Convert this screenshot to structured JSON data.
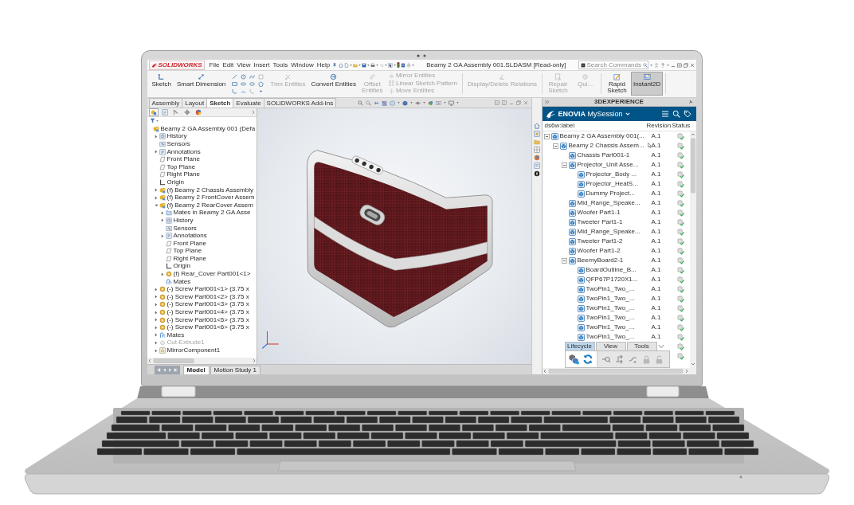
{
  "menu_bar": {
    "logo": "SOLIDWORKS",
    "menus": [
      "File",
      "Edit",
      "View",
      "Insert",
      "Tools",
      "Window",
      "Help"
    ],
    "title": "Beamy 2 GA Assembly 001.SLDASM [Read-only]",
    "search": {
      "placeholder": "Search Commands"
    }
  },
  "ribbon": {
    "commands": [
      {
        "kind": "large",
        "label": "Sketch",
        "disabled": false,
        "on": false
      },
      {
        "kind": "large",
        "label": "Smart Dimension",
        "disabled": false,
        "on": false
      },
      {
        "kind": "tools"
      },
      {
        "kind": "large",
        "label": "Trim Entities",
        "disabled": true,
        "on": false
      },
      {
        "kind": "large",
        "label": "Convert Entities",
        "disabled": false,
        "on": false
      },
      {
        "kind": "compact",
        "label": "Offset Entities",
        "disabled": true,
        "on": false
      },
      {
        "kind": "stack",
        "items": [
          {
            "label": "Mirror Entities",
            "disabled": true
          },
          {
            "label": "Linear Sketch Pattern",
            "disabled": true
          },
          {
            "label": "Move Entities",
            "disabled": true
          }
        ]
      },
      {
        "kind": "large",
        "label": "Display/Delete Relations",
        "disabled": true,
        "on": false
      },
      {
        "kind": "compact",
        "label": "Repair Sketch",
        "disabled": true,
        "on": false
      },
      {
        "kind": "compact",
        "label": "Qui...",
        "disabled": true,
        "on": false
      },
      {
        "kind": "compact",
        "label": "Rapid Sketch",
        "disabled": false,
        "on": false
      },
      {
        "kind": "large",
        "label": "Instant2D",
        "disabled": false,
        "on": true
      }
    ]
  },
  "command_tabs": [
    {
      "label": "Assembly",
      "selected": false
    },
    {
      "label": "Layout",
      "selected": false
    },
    {
      "label": "Sketch",
      "selected": true
    },
    {
      "label": "Evaluate",
      "selected": false
    },
    {
      "label": "SOLIDWORKS Add-Ins",
      "selected": false
    }
  ],
  "feature_manager": {
    "panel_tabs": [
      {
        "selected": true
      },
      {
        "selected": false
      },
      {
        "selected": false
      },
      {
        "selected": false
      },
      {
        "selected": false
      }
    ],
    "tree": [
      {
        "label": "Beamy 2 GA Assembly 001 (Defa",
        "kind": "assembly",
        "children": [
          {
            "label": "History",
            "kind": "history",
            "expanded": false
          },
          {
            "label": "Sensors",
            "kind": "sensors"
          },
          {
            "label": "Annotations",
            "kind": "annotations",
            "expanded": false
          },
          {
            "label": "Front Plane",
            "kind": "plane"
          },
          {
            "label": "Top Plane",
            "kind": "plane"
          },
          {
            "label": "Right Plane",
            "kind": "plane"
          },
          {
            "label": "Origin",
            "kind": "origin"
          },
          {
            "label": "(f) Beamy 2 Chassis Assembly",
            "kind": "assembly",
            "expanded": false
          },
          {
            "label": "(f) Beamy 2 FrontCover Assem",
            "kind": "assembly",
            "expanded": false
          },
          {
            "label": "(f) Beamy 2 RearCover Assem",
            "kind": "assembly",
            "expanded": true,
            "children": [
              {
                "label": "Mates in Beamy 2 GA Asse",
                "kind": "folder",
                "expanded": false
              },
              {
                "label": "History",
                "kind": "history",
                "expanded": false
              },
              {
                "label": "Sensors",
                "kind": "sensors"
              },
              {
                "label": "Annotations",
                "kind": "annotations",
                "expanded": false
              },
              {
                "label": "Front Plane",
                "kind": "plane"
              },
              {
                "label": "Top Plane",
                "kind": "plane"
              },
              {
                "label": "Right Plane",
                "kind": "plane"
              },
              {
                "label": "Origin",
                "kind": "origin"
              },
              {
                "label": "(f) Rear_Cover Part001<1>",
                "kind": "part",
                "expanded": false
              },
              {
                "label": "Mates",
                "kind": "mates"
              }
            ]
          },
          {
            "label": "(-) Screw Part001<1> (3.75 x",
            "kind": "part",
            "expanded": false
          },
          {
            "label": "(-) Screw Part001<2> (3.75 x",
            "kind": "part",
            "expanded": false
          },
          {
            "label": "(-) Screw Part001<3> (3.75 x",
            "kind": "part",
            "expanded": false
          },
          {
            "label": "(-) Screw Part001<4> (3.75 x",
            "kind": "part",
            "expanded": false
          },
          {
            "label": "(-) Screw Part001<5> (3.75 x",
            "kind": "part",
            "expanded": false
          },
          {
            "label": "(-) Screw Part001<6> (3.75 x",
            "kind": "part",
            "expanded": false
          },
          {
            "label": "Mates",
            "kind": "mates",
            "expanded": false
          },
          {
            "label": "Cut-Extrude1",
            "kind": "suppressed",
            "expanded": false
          },
          {
            "label": "MirrorComponent1",
            "kind": "mirror",
            "expanded": false
          }
        ]
      }
    ]
  },
  "bottom_tabs": [
    {
      "label": "Model",
      "selected": true
    },
    {
      "label": "Motion Study 1",
      "selected": false
    }
  ],
  "experience_panel": {
    "title": "3DEXPERIENCE",
    "app_name": "**ENOVIA** MySession",
    "columns": [
      "ds6w:label",
      "Revision",
      "Status"
    ],
    "rows": [
      {
        "label": "Beamy 2 GA Assembly 001(...",
        "revision": "A.1",
        "expanded": true,
        "children": [
          {
            "label": "Beamy 2 Chassis Assem...",
            "revision": "A.1",
            "expanded": true,
            "children": [
              {
                "label": "Chassis Part001-1",
                "revision": "A.1",
                "expanded": false
              },
              {
                "label": "Projector_Unit Asse...",
                "revision": "A.1",
                "expanded": true,
                "children": [
                  {
                    "label": "Projector_Body ...",
                    "revision": "A.1",
                    "expanded": false
                  },
                  {
                    "label": "Projector_HeatS...",
                    "revision": "A.1",
                    "expanded": false
                  },
                  {
                    "label": "Dummy Project...",
                    "revision": "A.1",
                    "expanded": false
                  }
                ]
              },
              {
                "label": "Mid_Range_Speake...",
                "revision": "A.1",
                "expanded": false
              },
              {
                "label": "Woofer Part1-1",
                "revision": "A.1",
                "expanded": false
              },
              {
                "label": "Tweeter Part1-1",
                "revision": "A.1",
                "expanded": false
              },
              {
                "label": "Mid_Range_Speake...",
                "revision": "A.1",
                "expanded": false
              },
              {
                "label": "Tweeter Part1-2",
                "revision": "A.1",
                "expanded": false
              },
              {
                "label": "Woofer Part1-2",
                "revision": "A.1",
                "expanded": false
              },
              {
                "label": "BeemyBoard2-1",
                "revision": "A.1",
                "expanded": true,
                "children": [
                  {
                    "label": "BoardOutline_B...",
                    "revision": "A.1",
                    "expanded": false
                  },
                  {
                    "label": "QFP67P1720X1...",
                    "revision": "A.1",
                    "expanded": false
                  },
                  {
                    "label": "TwoPin1_Two_...",
                    "revision": "A.1",
                    "expanded": false
                  },
                  {
                    "label": "TwoPin1_Two_...",
                    "revision": "A.1",
                    "expanded": false
                  },
                  {
                    "label": "TwoPin1_Two_...",
                    "revision": "A.1",
                    "expanded": false
                  },
                  {
                    "label": "TwoPin1_Two_...",
                    "revision": "A.1",
                    "expanded": false
                  },
                  {
                    "label": "TwoPin1_Two_...",
                    "revision": "A.1",
                    "expanded": false
                  },
                  {
                    "label": "TwoPin1_Two_...",
                    "revision": "A.1",
                    "expanded": false
                  },
                  {
                    "expanded": false
                  },
                  {
                    "expanded": false
                  }
                ]
              }
            ]
          }
        ]
      }
    ],
    "toolbar_tabs": [
      {
        "label": "Lifecycle",
        "selected": true
      },
      {
        "label": "View",
        "selected": false
      },
      {
        "label": "Tools",
        "selected": false
      }
    ]
  }
}
